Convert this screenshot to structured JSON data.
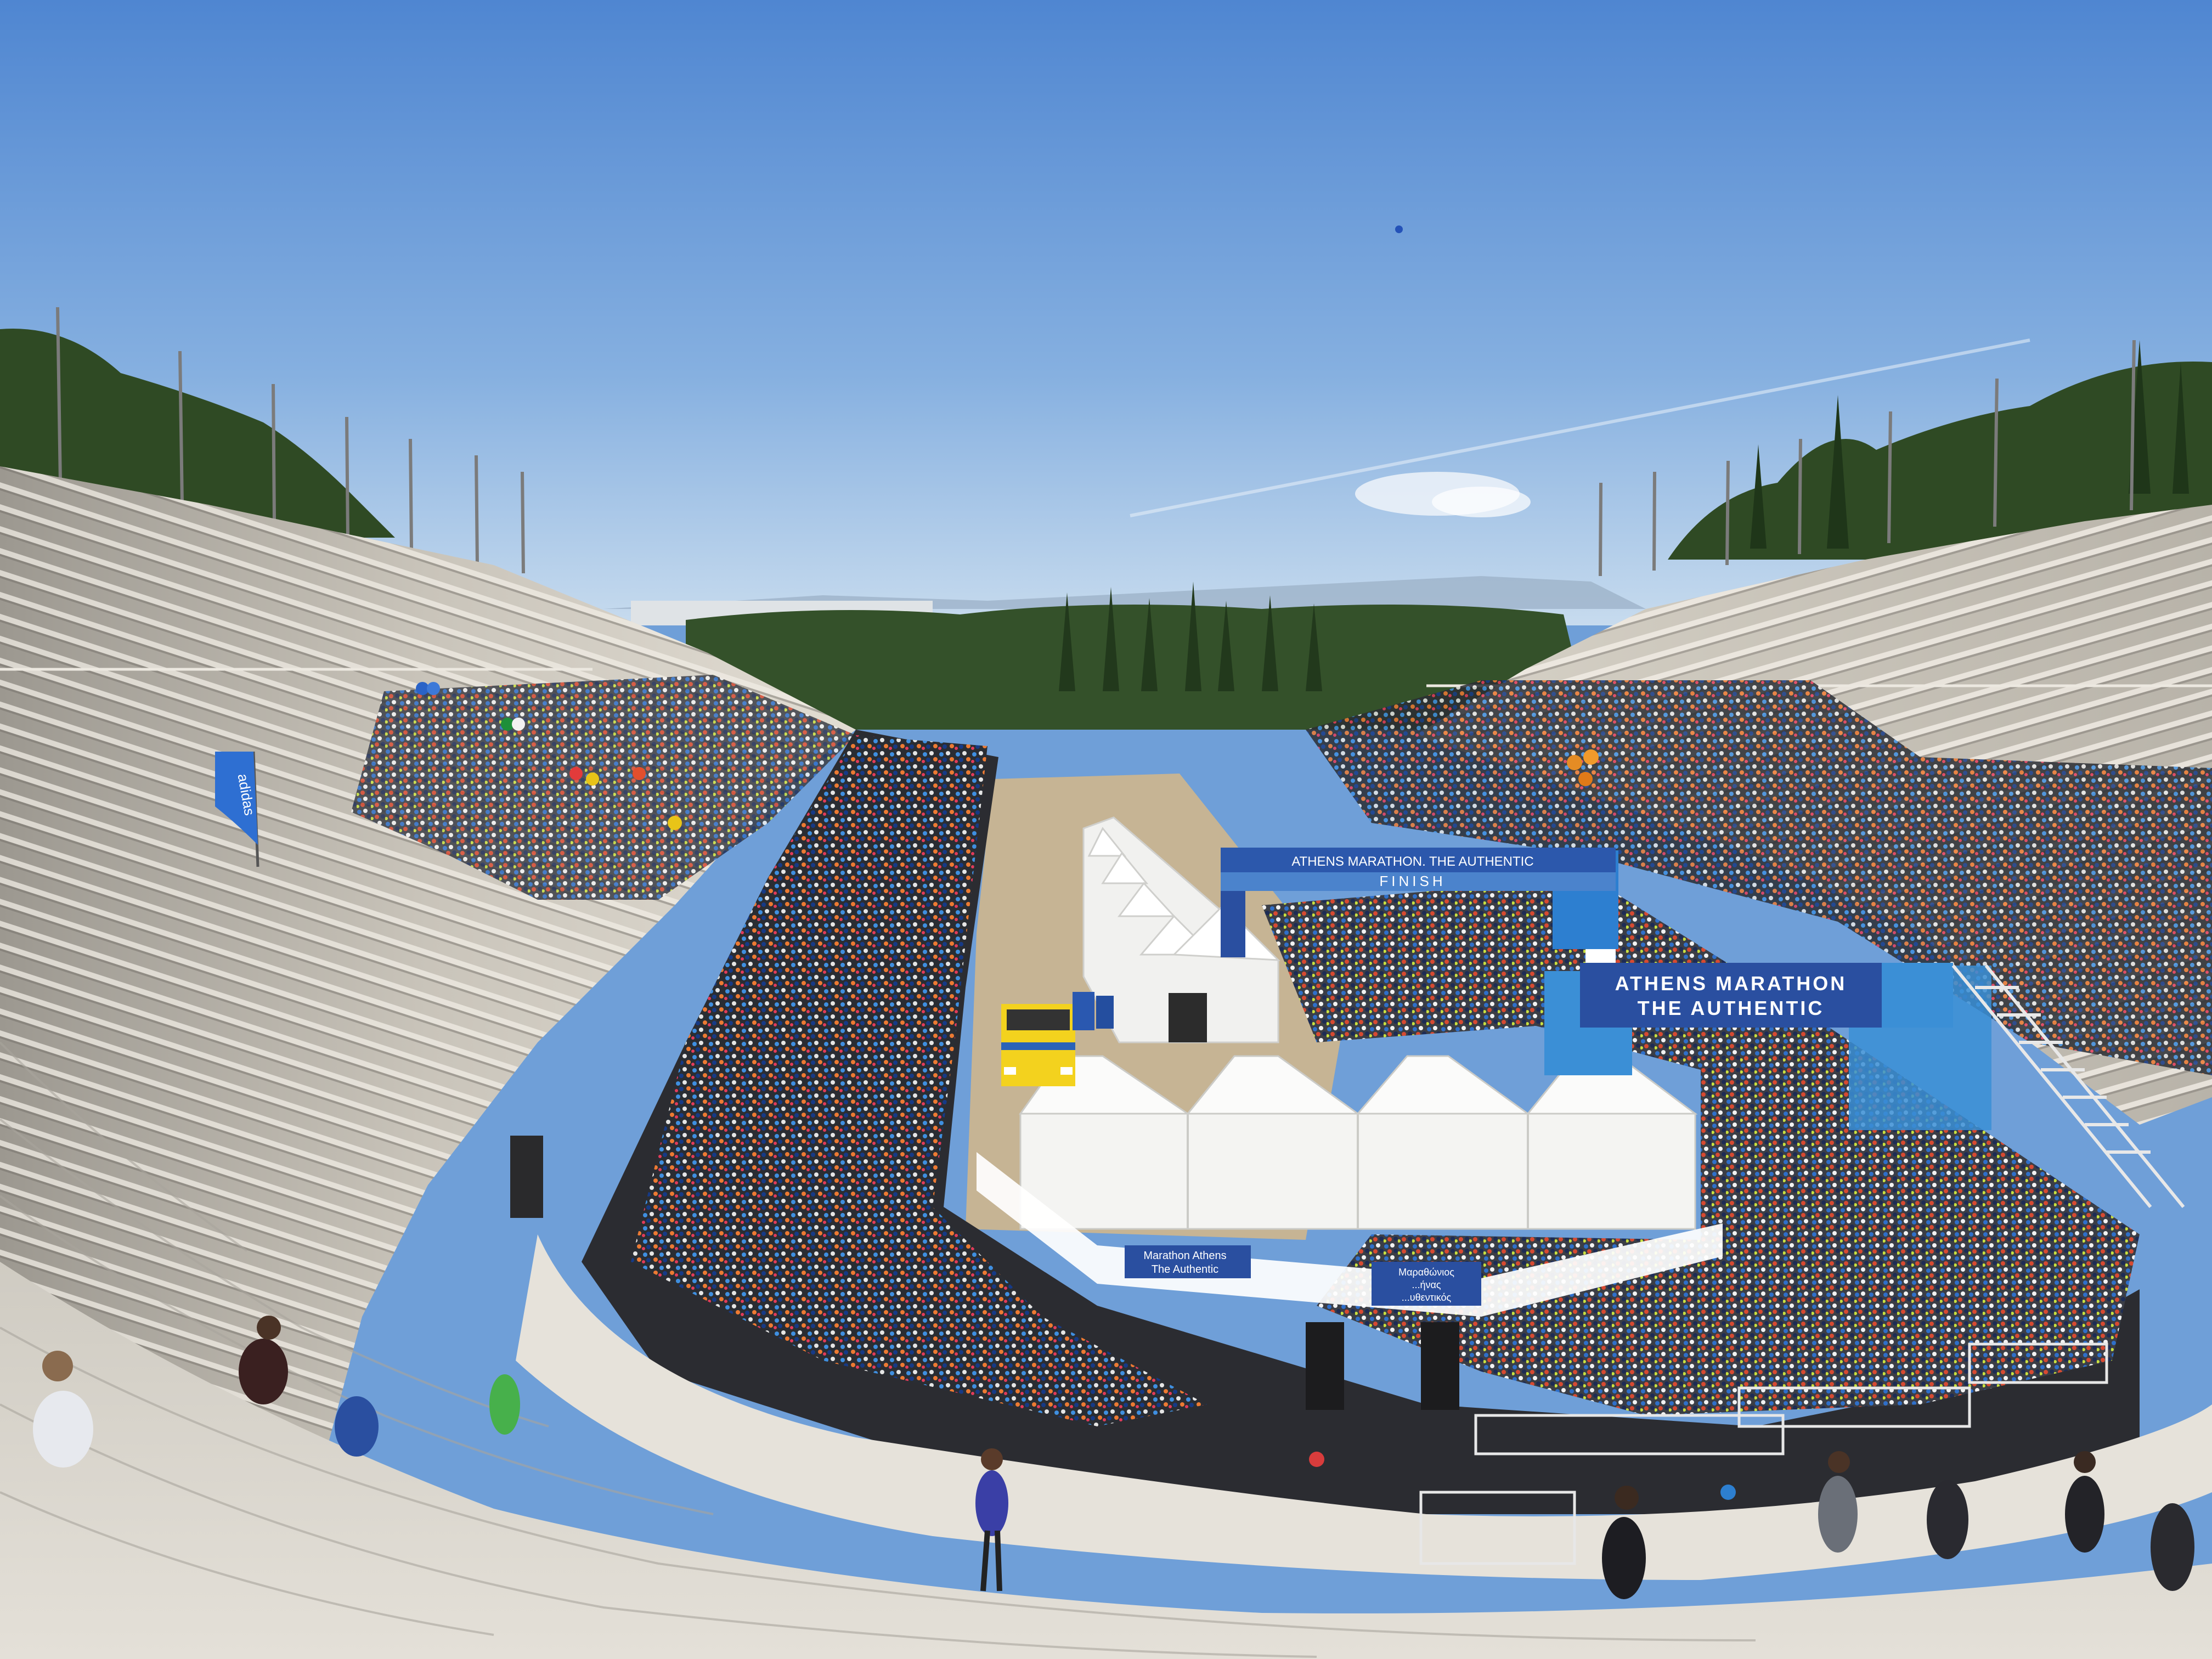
{
  "photo": {
    "finish_arch": {
      "top_label": "ATHENS MARATHON. THE AUTHENTIC",
      "finish_label": "FINISH"
    },
    "side_banner": {
      "line1": "ATHENS MARATHON",
      "line2": "THE AUTHENTIC"
    },
    "fence_banner": {
      "line1": "Marathon Athens",
      "line2": "The Authentic"
    },
    "fence_banner_greek": {
      "line1": "Μαραθώνιος",
      "line2": "...ήνας",
      "line3": "...υθεντικός"
    },
    "flag_banner": "adidas",
    "colors": {
      "sky_top": "#5a8fd6",
      "sky_bottom": "#b9d3ea",
      "marble": "#d9d5cc",
      "marble_shadow": "#8e8a84",
      "track": "#2b2c31",
      "sand": "#c9b79a",
      "tent": "#f4f4f2",
      "banner_blue": "#2a4fa0",
      "banner_light": "#3b8fd6",
      "trees": "#2f4a24"
    }
  }
}
